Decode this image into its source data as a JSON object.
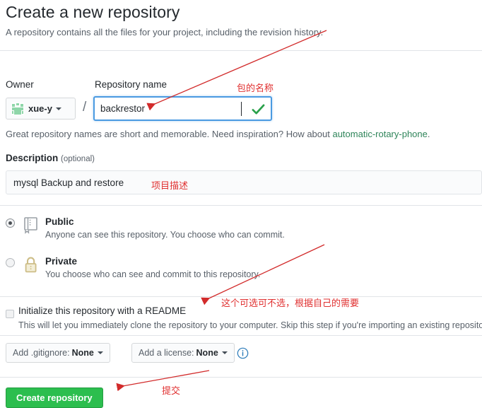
{
  "header": {
    "title": "Create a new repository",
    "subtitle": "A repository contains all the files for your project, including the revision history."
  },
  "owner": {
    "label": "Owner",
    "name": "xue-y",
    "avatar_icon": "identicon-avatar",
    "caret_icon": "caret-down-icon",
    "separator": "/"
  },
  "repo_name": {
    "label": "Repository name",
    "value": "backrestor",
    "placeholder": "",
    "valid_icon": "check-icon",
    "hint_prefix": "Great repository names are short and memorable. Need inspiration? How about ",
    "hint_suggestion": "automatic-rotary-phone",
    "hint_suffix": "."
  },
  "description": {
    "label": "Description",
    "optional_label": "(optional)",
    "value": "mysql Backup and restore",
    "placeholder": ""
  },
  "visibility": {
    "options": [
      {
        "id": "public",
        "title": "Public",
        "description": "Anyone can see this repository. You choose who can commit.",
        "selected": true,
        "icon": "repo-book-icon"
      },
      {
        "id": "private",
        "title": "Private",
        "description": "You choose who can see and commit to this repository.",
        "selected": false,
        "icon": "lock-icon"
      }
    ]
  },
  "readme": {
    "label": "Initialize this repository with a README",
    "description": "This will let you immediately clone the repository to your computer. Skip this step if you're importing an existing repository.",
    "checked": false
  },
  "gitignore": {
    "prefix": "Add .gitignore:",
    "value": "None",
    "caret_icon": "caret-down-icon"
  },
  "license": {
    "prefix": "Add a license:",
    "value": "None",
    "caret_icon": "caret-down-icon",
    "info_icon": "info-circle-icon"
  },
  "submit": {
    "label": "Create repository"
  },
  "annotations": [
    {
      "text": "包的名称",
      "meaning": "package name"
    },
    {
      "text": "项目描述",
      "meaning": "project description"
    },
    {
      "text": "这个可选可不选，根据自己的需要",
      "meaning": "this is optional, based on your own needs"
    },
    {
      "text": "提交",
      "meaning": "submit"
    }
  ],
  "colors": {
    "annotation_red": "#e03030",
    "submit_green": "#2cbe4e",
    "suggestion_green": "#2f855a",
    "focus_blue": "#4a9ae1",
    "lock_gold": "#d3c08a",
    "info_blue": "#2b7bb9"
  }
}
